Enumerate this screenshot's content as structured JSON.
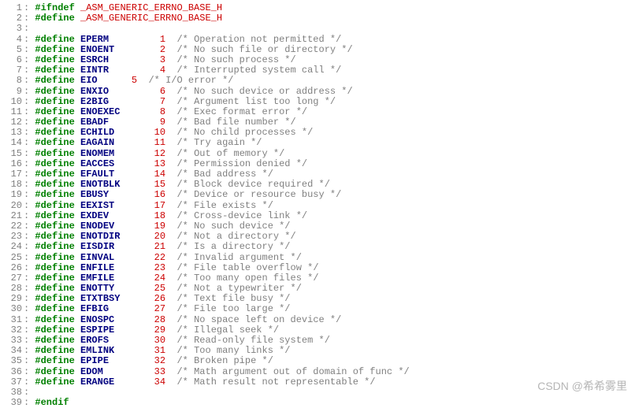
{
  "watermark": "CSDN @希希雾里",
  "lines": [
    {
      "n": 1,
      "type": "ifndef",
      "keyword": "#ifndef",
      "gap": " ",
      "name": "_ASM_GENERIC_ERRNO_BASE_H"
    },
    {
      "n": 2,
      "type": "define-guard",
      "keyword": "#define",
      "gap": " ",
      "name": "_ASM_GENERIC_ERRNO_BASE_H"
    },
    {
      "n": 3,
      "type": "blank"
    },
    {
      "n": 4,
      "type": "define",
      "keyword": "#define",
      "gap": " ",
      "name": "EPERM",
      "pad": "         ",
      "num": "1",
      "cgap": "  ",
      "comment": "/* Operation not permitted */"
    },
    {
      "n": 5,
      "type": "define",
      "keyword": "#define",
      "gap": " ",
      "name": "ENOENT",
      "pad": "        ",
      "num": "2",
      "cgap": "  ",
      "comment": "/* No such file or directory */"
    },
    {
      "n": 6,
      "type": "define",
      "keyword": "#define",
      "gap": " ",
      "name": "ESRCH",
      "pad": "         ",
      "num": "3",
      "cgap": "  ",
      "comment": "/* No such process */"
    },
    {
      "n": 7,
      "type": "define",
      "keyword": "#define",
      "gap": " ",
      "name": "EINTR",
      "pad": "         ",
      "num": "4",
      "cgap": "  ",
      "comment": "/* Interrupted system call */"
    },
    {
      "n": 8,
      "type": "define",
      "keyword": "#define",
      "gap": " ",
      "name": "EIO",
      "pad": "      ",
      "num": "5",
      "cgap": "  ",
      "comment": "/* I/O error */"
    },
    {
      "n": 9,
      "type": "define",
      "keyword": "#define",
      "gap": " ",
      "name": "ENXIO",
      "pad": "         ",
      "num": "6",
      "cgap": "  ",
      "comment": "/* No such device or address */"
    },
    {
      "n": 10,
      "type": "define",
      "keyword": "#define",
      "gap": " ",
      "name": "E2BIG",
      "pad": "         ",
      "num": "7",
      "cgap": "  ",
      "comment": "/* Argument list too long */"
    },
    {
      "n": 11,
      "type": "define",
      "keyword": "#define",
      "gap": " ",
      "name": "ENOEXEC",
      "pad": "       ",
      "num": "8",
      "cgap": "  ",
      "comment": "/* Exec format error */"
    },
    {
      "n": 12,
      "type": "define",
      "keyword": "#define",
      "gap": " ",
      "name": "EBADF",
      "pad": "         ",
      "num": "9",
      "cgap": "  ",
      "comment": "/* Bad file number */"
    },
    {
      "n": 13,
      "type": "define",
      "keyword": "#define",
      "gap": " ",
      "name": "ECHILD",
      "pad": "       ",
      "num": "10",
      "cgap": "  ",
      "comment": "/* No child processes */"
    },
    {
      "n": 14,
      "type": "define",
      "keyword": "#define",
      "gap": " ",
      "name": "EAGAIN",
      "pad": "       ",
      "num": "11",
      "cgap": "  ",
      "comment": "/* Try again */"
    },
    {
      "n": 15,
      "type": "define",
      "keyword": "#define",
      "gap": " ",
      "name": "ENOMEM",
      "pad": "       ",
      "num": "12",
      "cgap": "  ",
      "comment": "/* Out of memory */"
    },
    {
      "n": 16,
      "type": "define",
      "keyword": "#define",
      "gap": " ",
      "name": "EACCES",
      "pad": "       ",
      "num": "13",
      "cgap": "  ",
      "comment": "/* Permission denied */"
    },
    {
      "n": 17,
      "type": "define",
      "keyword": "#define",
      "gap": " ",
      "name": "EFAULT",
      "pad": "       ",
      "num": "14",
      "cgap": "  ",
      "comment": "/* Bad address */"
    },
    {
      "n": 18,
      "type": "define",
      "keyword": "#define",
      "gap": " ",
      "name": "ENOTBLK",
      "pad": "      ",
      "num": "15",
      "cgap": "  ",
      "comment": "/* Block device required */"
    },
    {
      "n": 19,
      "type": "define",
      "keyword": "#define",
      "gap": " ",
      "name": "EBUSY",
      "pad": "        ",
      "num": "16",
      "cgap": "  ",
      "comment": "/* Device or resource busy */"
    },
    {
      "n": 20,
      "type": "define",
      "keyword": "#define",
      "gap": " ",
      "name": "EEXIST",
      "pad": "       ",
      "num": "17",
      "cgap": "  ",
      "comment": "/* File exists */"
    },
    {
      "n": 21,
      "type": "define",
      "keyword": "#define",
      "gap": " ",
      "name": "EXDEV",
      "pad": "        ",
      "num": "18",
      "cgap": "  ",
      "comment": "/* Cross-device link */"
    },
    {
      "n": 22,
      "type": "define",
      "keyword": "#define",
      "gap": " ",
      "name": "ENODEV",
      "pad": "       ",
      "num": "19",
      "cgap": "  ",
      "comment": "/* No such device */"
    },
    {
      "n": 23,
      "type": "define",
      "keyword": "#define",
      "gap": " ",
      "name": "ENOTDIR",
      "pad": "      ",
      "num": "20",
      "cgap": "  ",
      "comment": "/* Not a directory */"
    },
    {
      "n": 24,
      "type": "define",
      "keyword": "#define",
      "gap": " ",
      "name": "EISDIR",
      "pad": "       ",
      "num": "21",
      "cgap": "  ",
      "comment": "/* Is a directory */"
    },
    {
      "n": 25,
      "type": "define",
      "keyword": "#define",
      "gap": " ",
      "name": "EINVAL",
      "pad": "       ",
      "num": "22",
      "cgap": "  ",
      "comment": "/* Invalid argument */"
    },
    {
      "n": 26,
      "type": "define",
      "keyword": "#define",
      "gap": " ",
      "name": "ENFILE",
      "pad": "       ",
      "num": "23",
      "cgap": "  ",
      "comment": "/* File table overflow */"
    },
    {
      "n": 27,
      "type": "define",
      "keyword": "#define",
      "gap": " ",
      "name": "EMFILE",
      "pad": "       ",
      "num": "24",
      "cgap": "  ",
      "comment": "/* Too many open files */"
    },
    {
      "n": 28,
      "type": "define",
      "keyword": "#define",
      "gap": " ",
      "name": "ENOTTY",
      "pad": "       ",
      "num": "25",
      "cgap": "  ",
      "comment": "/* Not a typewriter */"
    },
    {
      "n": 29,
      "type": "define",
      "keyword": "#define",
      "gap": " ",
      "name": "ETXTBSY",
      "pad": "      ",
      "num": "26",
      "cgap": "  ",
      "comment": "/* Text file busy */"
    },
    {
      "n": 30,
      "type": "define",
      "keyword": "#define",
      "gap": " ",
      "name": "EFBIG",
      "pad": "        ",
      "num": "27",
      "cgap": "  ",
      "comment": "/* File too large */"
    },
    {
      "n": 31,
      "type": "define",
      "keyword": "#define",
      "gap": " ",
      "name": "ENOSPC",
      "pad": "       ",
      "num": "28",
      "cgap": "  ",
      "comment": "/* No space left on device */"
    },
    {
      "n": 32,
      "type": "define",
      "keyword": "#define",
      "gap": " ",
      "name": "ESPIPE",
      "pad": "       ",
      "num": "29",
      "cgap": "  ",
      "comment": "/* Illegal seek */"
    },
    {
      "n": 33,
      "type": "define",
      "keyword": "#define",
      "gap": " ",
      "name": "EROFS",
      "pad": "        ",
      "num": "30",
      "cgap": "  ",
      "comment": "/* Read-only file system */"
    },
    {
      "n": 34,
      "type": "define",
      "keyword": "#define",
      "gap": " ",
      "name": "EMLINK",
      "pad": "       ",
      "num": "31",
      "cgap": "  ",
      "comment": "/* Too many links */"
    },
    {
      "n": 35,
      "type": "define",
      "keyword": "#define",
      "gap": " ",
      "name": "EPIPE",
      "pad": "        ",
      "num": "32",
      "cgap": "  ",
      "comment": "/* Broken pipe */"
    },
    {
      "n": 36,
      "type": "define",
      "keyword": "#define",
      "gap": " ",
      "name": "EDOM",
      "pad": "         ",
      "num": "33",
      "cgap": "  ",
      "comment": "/* Math argument out of domain of func */"
    },
    {
      "n": 37,
      "type": "define",
      "keyword": "#define",
      "gap": " ",
      "name": "ERANGE",
      "pad": "       ",
      "num": "34",
      "cgap": "  ",
      "comment": "/* Math result not representable */"
    },
    {
      "n": 38,
      "type": "blank"
    },
    {
      "n": 39,
      "type": "endif",
      "keyword": "#endif"
    }
  ]
}
